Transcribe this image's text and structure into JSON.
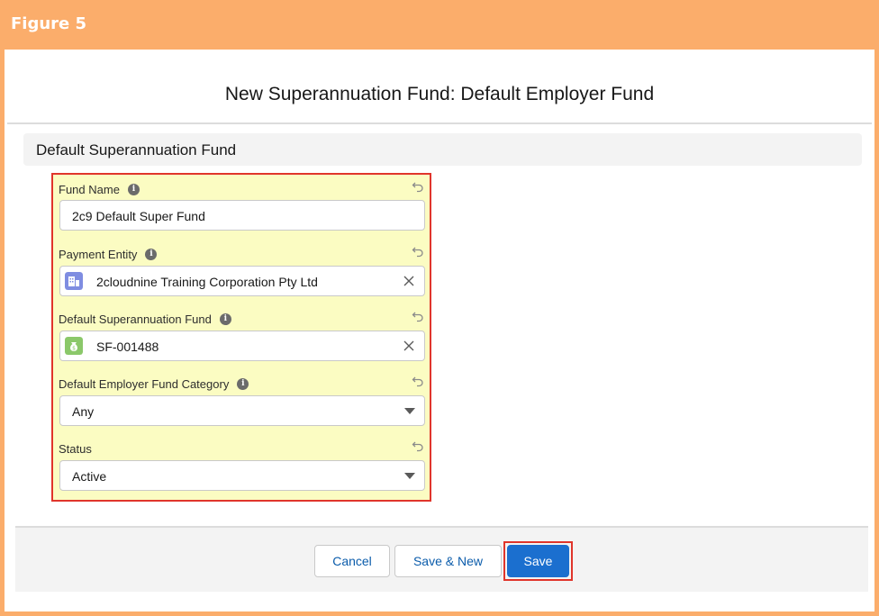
{
  "figure": {
    "label": "Figure 5"
  },
  "modal": {
    "title": "New Superannuation Fund: Default Employer Fund"
  },
  "section": {
    "title": "Default Superannuation Fund"
  },
  "fields": [
    {
      "label": "Fund Name",
      "value": "2c9 Default Super Fund",
      "kind": "text",
      "has_info": true
    },
    {
      "label": "Payment Entity",
      "value": "2cloudnine Training Corporation Pty Ltd",
      "kind": "lookup",
      "icon": "building-icon",
      "icon_color": "#7f8de1",
      "has_info": true
    },
    {
      "label": "Default Superannuation Fund",
      "value": "SF-001488",
      "kind": "lookup",
      "icon": "money-bag-icon",
      "icon_color": "#8bc86a",
      "has_info": true
    },
    {
      "label": "Default Employer Fund Category",
      "value": "Any",
      "kind": "picklist",
      "has_info": true
    },
    {
      "label": "Status",
      "value": "Active",
      "kind": "picklist",
      "has_info": false
    }
  ],
  "buttons": {
    "cancel": "Cancel",
    "save_new": "Save & New",
    "save": "Save"
  },
  "colors": {
    "header": "#fbad6b",
    "highlight": "#e0352b",
    "form_bg": "#fbfcc2",
    "brand": "#1b6fcf"
  }
}
